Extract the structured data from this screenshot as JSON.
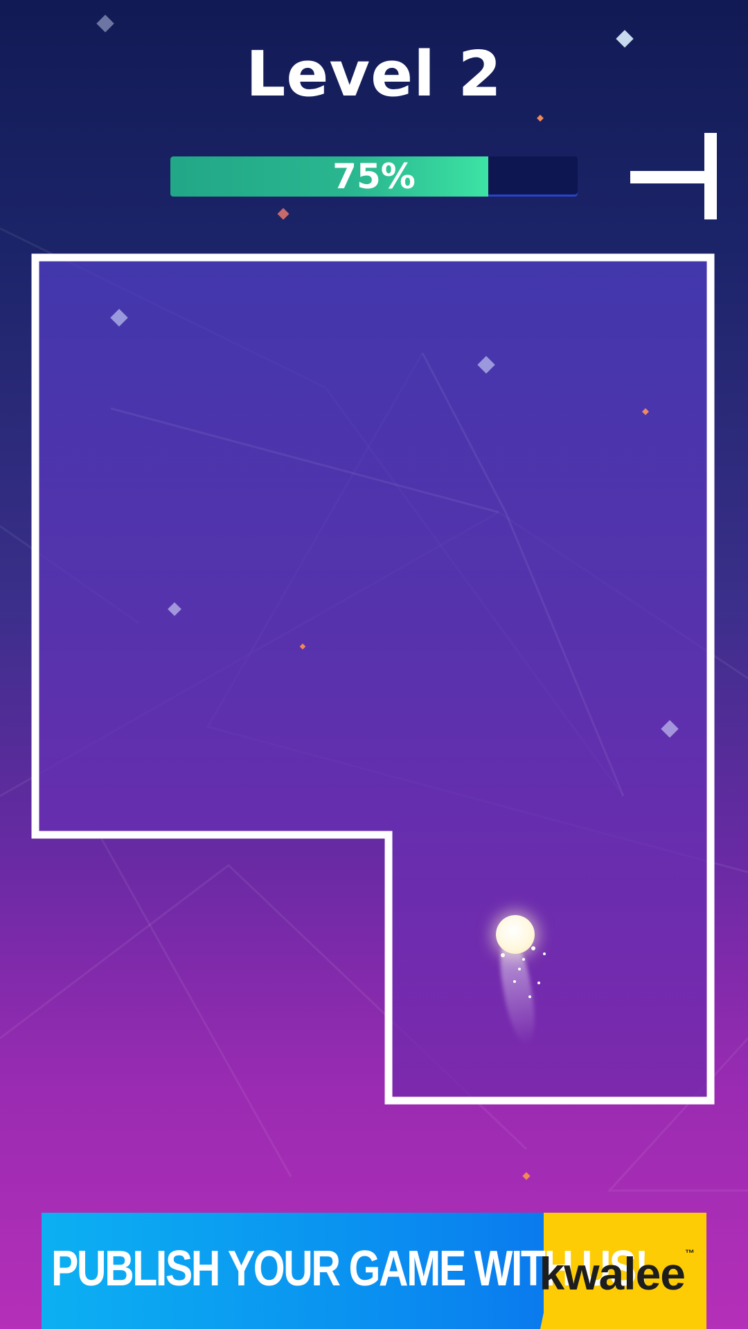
{
  "level": {
    "title": "Level 2"
  },
  "progress": {
    "fraction": 0.78,
    "label": "75%"
  },
  "pause_button": {
    "icon": "pause-icon"
  },
  "ad": {
    "headline": "PUBLISH YOUR GAME WITH US!",
    "brand": "kwalee"
  },
  "colors": {
    "progress_fill": "#2ab890",
    "field_outline": "#ffffff",
    "ad_blue": "#0a90f0",
    "ad_yellow": "#fecc04"
  }
}
